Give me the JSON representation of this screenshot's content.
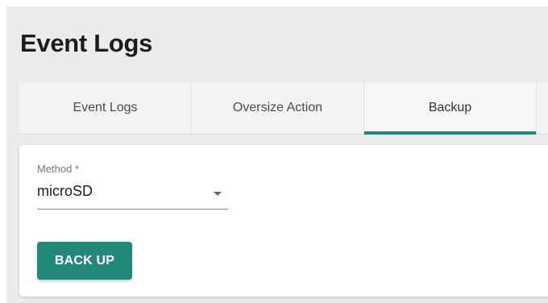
{
  "page": {
    "title": "Event Logs"
  },
  "tabs": [
    {
      "label": "Event Logs",
      "active": false
    },
    {
      "label": "Oversize Action",
      "active": false
    },
    {
      "label": "Backup",
      "active": true
    }
  ],
  "backup_form": {
    "method_label": "Method *",
    "method_value": "microSD",
    "dropdown_icon": "chevron-down-icon",
    "backup_button_label": "BACK UP"
  },
  "colors": {
    "accent": "#23877a",
    "page_background": "#ebebeb",
    "card_background": "#ffffff"
  }
}
